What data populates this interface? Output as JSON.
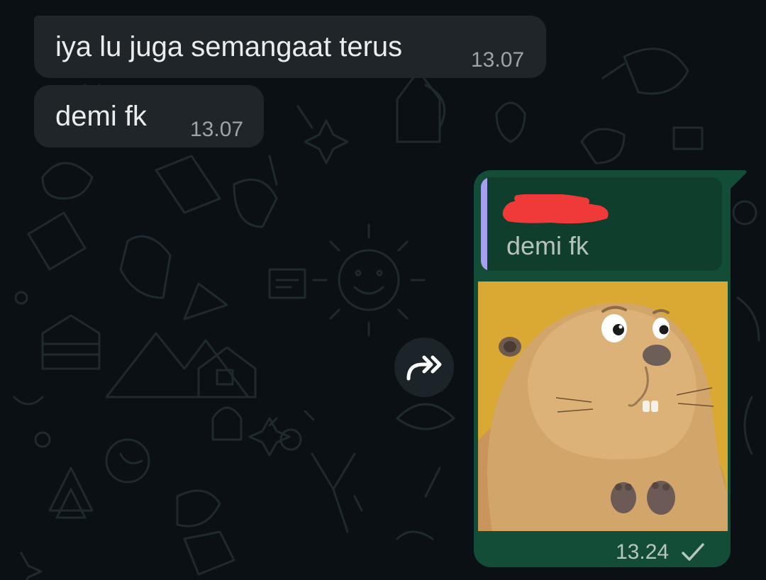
{
  "messages": [
    {
      "text": "iya lu juga semangaat terus",
      "time": "13.07",
      "direction": "incoming"
    },
    {
      "text": "demi fk",
      "time": "13.07",
      "direction": "incoming"
    }
  ],
  "outgoing": {
    "reply_to": {
      "text": "demi fk"
    },
    "time": "13.24",
    "status": "sent",
    "status_icon": "single-check-icon"
  },
  "forward_icon": "forward-arrow-icon",
  "colors": {
    "background": "#0b1014",
    "incoming_bubble": "#1f2528",
    "outgoing_bubble": "#134d37",
    "quote_accent": "#a5a0ef",
    "redaction": "#f03a3a"
  }
}
